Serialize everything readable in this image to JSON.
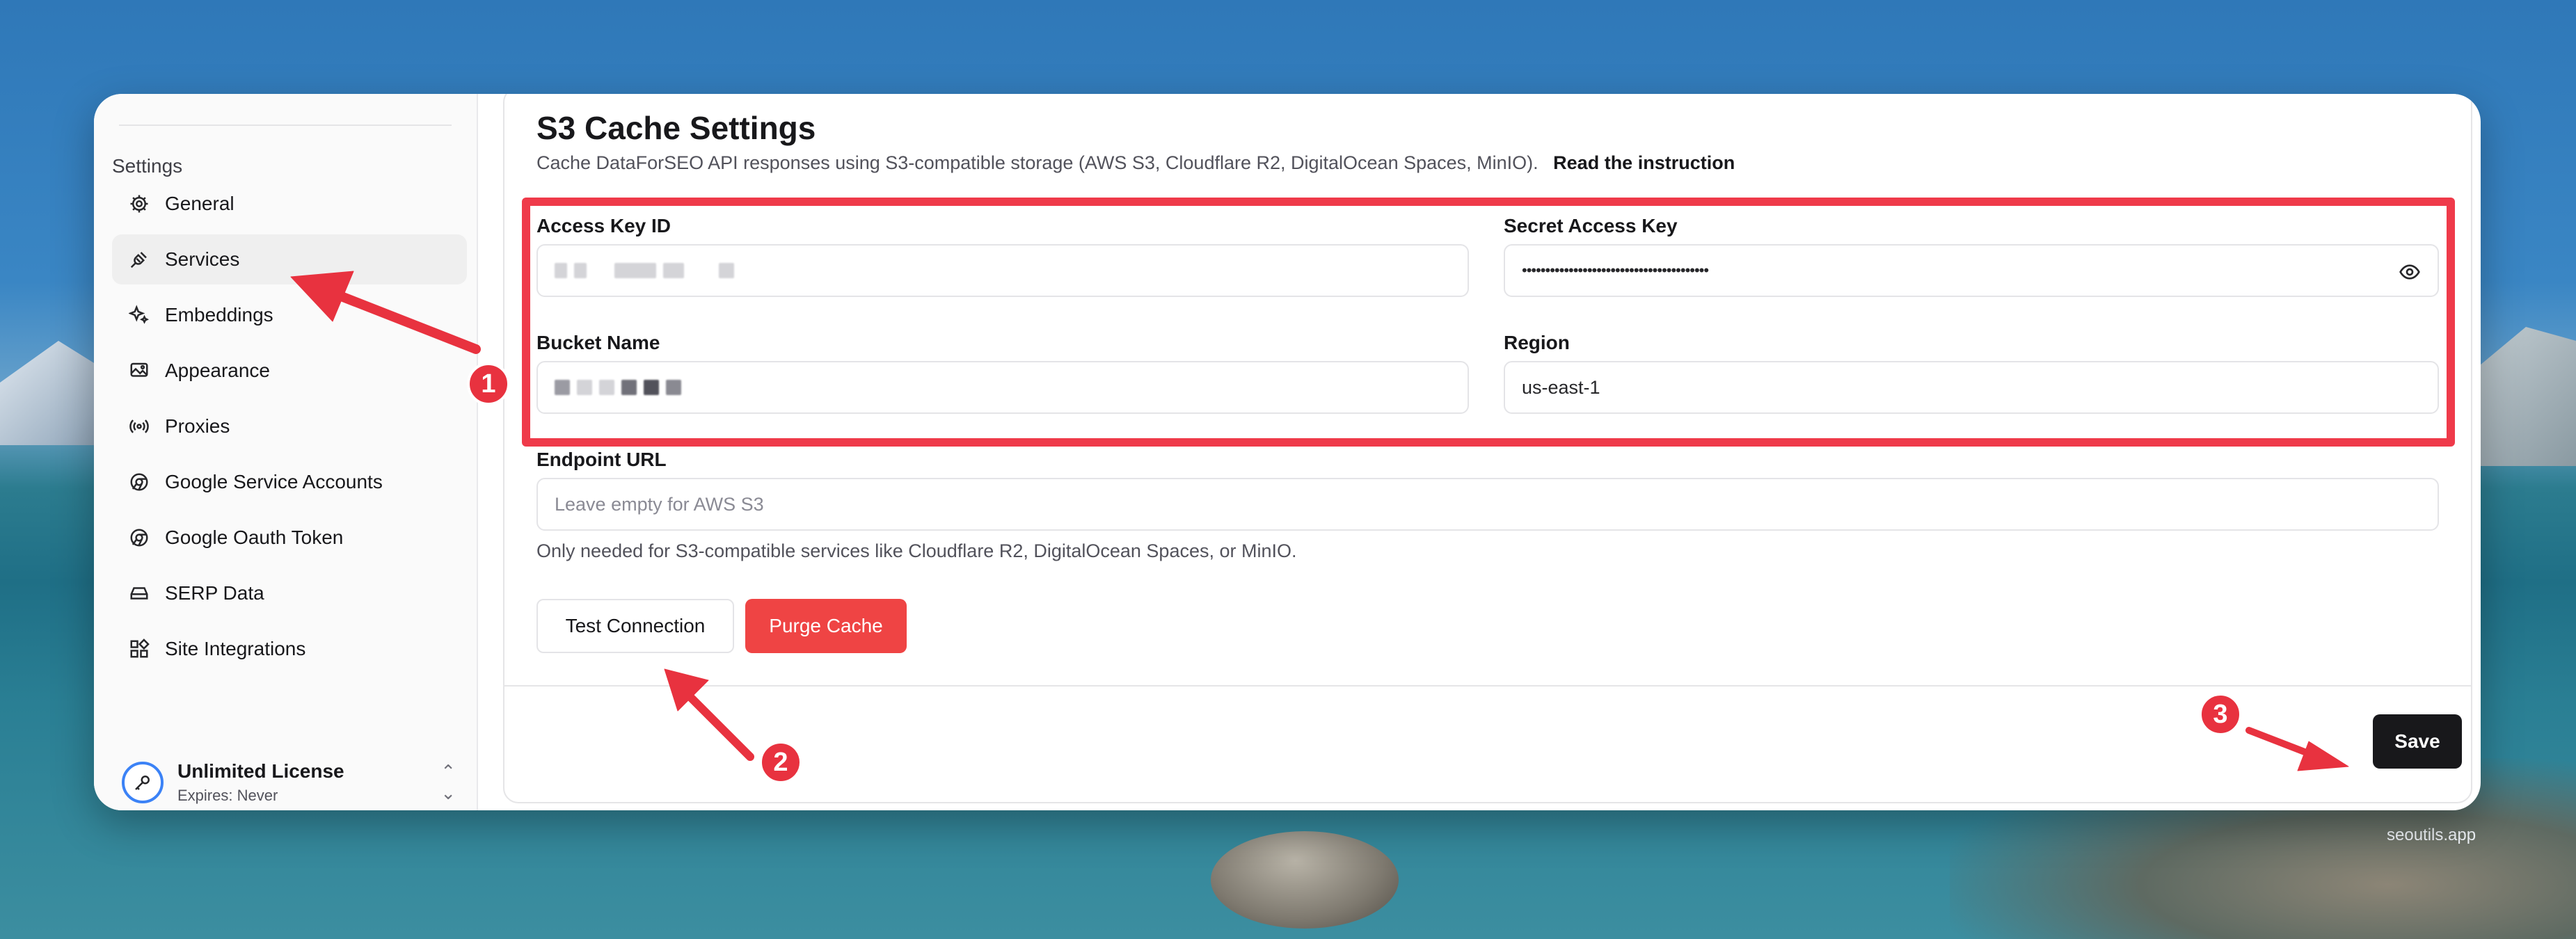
{
  "sidebar": {
    "heading": "Settings",
    "items": [
      {
        "label": "General",
        "icon": "gear-icon"
      },
      {
        "label": "Services",
        "icon": "plug-icon"
      },
      {
        "label": "Embeddings",
        "icon": "sparkles-icon"
      },
      {
        "label": "Appearance",
        "icon": "image-icon"
      },
      {
        "label": "Proxies",
        "icon": "radio-icon"
      },
      {
        "label": "Google Service Accounts",
        "icon": "chrome-icon"
      },
      {
        "label": "Google Oauth Token",
        "icon": "chrome-icon"
      },
      {
        "label": "SERP Data",
        "icon": "drive-icon"
      },
      {
        "label": "Site Integrations",
        "icon": "grid-icon"
      }
    ],
    "license": {
      "title": "Unlimited License",
      "expires": "Expires: Never"
    }
  },
  "main": {
    "title": "S3 Cache Settings",
    "subtitle": "Cache DataForSEO API responses using S3-compatible storage (AWS S3, Cloudflare R2, DigitalOcean Spaces, MinIO).",
    "instruction_link": "Read the instruction",
    "fields": {
      "access_key_label": "Access Key ID",
      "secret_key_label": "Secret Access Key",
      "secret_key_value": "••••••••••••••••••••••••••••••••••••••••",
      "bucket_label": "Bucket Name",
      "region_label": "Region",
      "region_value": "us-east-1",
      "endpoint_label": "Endpoint URL",
      "endpoint_placeholder": "Leave empty for AWS S3",
      "endpoint_hint": "Only needed for S3-compatible services like Cloudflare R2, DigitalOcean Spaces, or MinIO."
    },
    "buttons": {
      "test": "Test Connection",
      "purge": "Purge Cache",
      "save": "Save"
    }
  },
  "annotations": {
    "step1": "1",
    "step2": "2",
    "step3": "3"
  },
  "watermark": "seoutils.app",
  "colors": {
    "accent_red": "#ef3a4a",
    "danger": "#ef4444",
    "primary": "#18181b",
    "license_ring": "#3b82f6"
  }
}
